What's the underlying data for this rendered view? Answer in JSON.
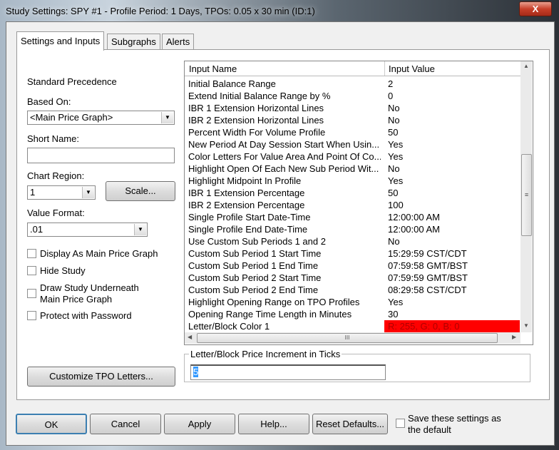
{
  "window": {
    "title": "Study Settings: SPY  #1 - Profile Period: 1 Days, TPOs: 0.05 x 30 min   (ID:1)",
    "close": "X"
  },
  "tabs": [
    "Settings and Inputs",
    "Subgraphs",
    "Alerts"
  ],
  "left": {
    "precedence": "Standard Precedence",
    "based_on_label": "Based On:",
    "based_on_value": "<Main Price Graph>",
    "short_name_label": "Short Name:",
    "short_name_value": "",
    "chart_region_label": "Chart Region:",
    "chart_region_value": "1",
    "scale_button": "Scale...",
    "value_format_label": "Value Format:",
    "value_format_value": ".01",
    "checkboxes": [
      {
        "label": "Display As Main Price Graph",
        "checked": false
      },
      {
        "label": "Hide Study",
        "checked": false
      },
      {
        "label": "Draw Study Underneath Main Price Graph",
        "checked": false
      },
      {
        "label": "Protect with Password",
        "checked": false
      }
    ],
    "customize_button": "Customize TPO Letters..."
  },
  "grid": {
    "col_name": "Input Name",
    "col_value": "Input Value",
    "rows": [
      [
        "Initial Balance Range",
        "2"
      ],
      [
        "Extend Initial Balance Range by %",
        "0"
      ],
      [
        "IBR 1 Extension Horizontal Lines",
        "No"
      ],
      [
        "IBR 2 Extension Horizontal Lines",
        "No"
      ],
      [
        "Percent Width For Volume Profile",
        "50"
      ],
      [
        "New Period At Day Session Start When Usin...",
        "Yes"
      ],
      [
        "Color Letters For Value Area And Point Of Co...",
        "Yes"
      ],
      [
        "Highlight Open Of Each New Sub Period Wit...",
        "No"
      ],
      [
        "Highlight Midpoint In Profile",
        "Yes"
      ],
      [
        "IBR 1 Extension Percentage",
        "50"
      ],
      [
        "IBR 2 Extension Percentage",
        "100"
      ],
      [
        "Single Profile Start Date-Time",
        "12:00:00 AM"
      ],
      [
        "Single Profile End Date-Time",
        "12:00:00 AM"
      ],
      [
        "Use Custom Sub Periods 1 and 2",
        "No"
      ],
      [
        "Custom Sub Period 1 Start Time",
        "15:29:59 CST/CDT"
      ],
      [
        "Custom Sub Period 1 End Time",
        "07:59:58 GMT/BST"
      ],
      [
        "Custom Sub Period 2 Start Time",
        "07:59:59 GMT/BST"
      ],
      [
        "Custom Sub Period 2 End Time",
        "08:29:58 CST/CDT"
      ],
      [
        "Highlight Opening Range on TPO Profiles",
        "Yes"
      ],
      [
        "Opening Range Time Length in Minutes",
        "30"
      ],
      [
        "Letter/Block Color 1",
        "R: 255, G: 0, B: 0"
      ]
    ],
    "selected_color": "#ff0000"
  },
  "editor": {
    "label": "Letter/Block Price Increment in Ticks",
    "value": "5"
  },
  "buttons": {
    "ok": "OK",
    "cancel": "Cancel",
    "apply": "Apply",
    "help": "Help...",
    "reset": "Reset Defaults...",
    "save_default": "Save these settings as the default"
  }
}
